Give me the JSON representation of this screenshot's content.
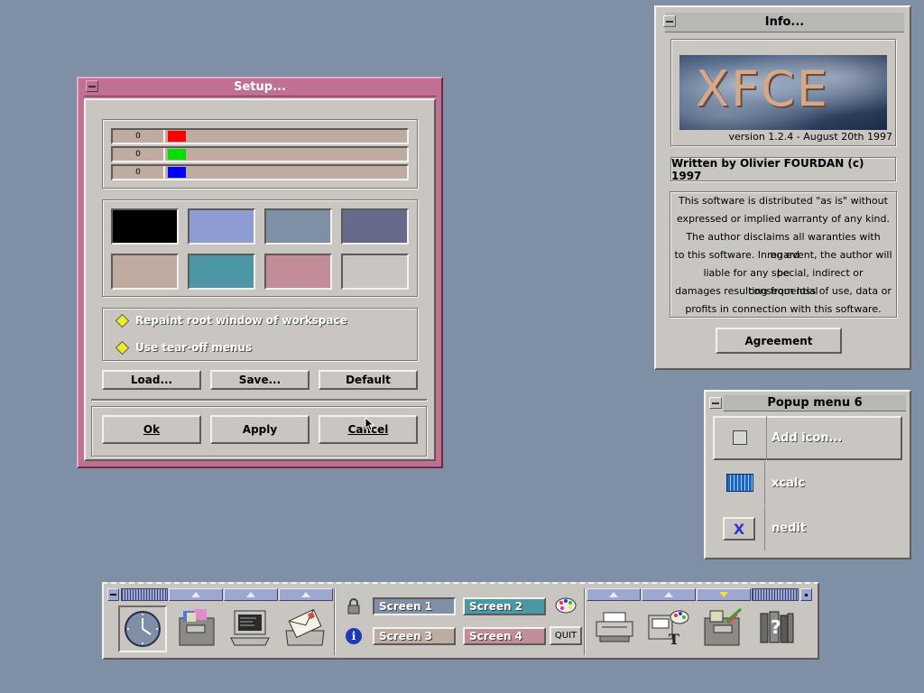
{
  "colors": {
    "desktop": "#7e8fa6",
    "window_face": "#c9c6c2",
    "active_title": "#c07092",
    "slider_trough": "#c0aba0",
    "panel_tab": "#9ea7cf"
  },
  "setup": {
    "title": "Setup...",
    "sliders": [
      {
        "value": "0",
        "color": "#ff0000"
      },
      {
        "value": "0",
        "color": "#00e000"
      },
      {
        "value": "0",
        "color": "#0000ff"
      }
    ],
    "swatches": [
      "#000000",
      "#8f9bd3",
      "#7e8fa6",
      "#676b8b",
      "#c0aba0",
      "#4b97a5",
      "#c38d98",
      "#c9c6c2"
    ],
    "options": {
      "repaint": "Repaint root window of workspace",
      "tearoff": "Use tear-off menus"
    },
    "buttons": {
      "load": "Load...",
      "save": "Save...",
      "default": "Default",
      "ok": "Ok",
      "apply": "Apply",
      "cancel": "Cancel"
    }
  },
  "info": {
    "title": "Info...",
    "logo_text": "XFCE",
    "version": "version 1.2.4 - August 20th 1997",
    "author": "Written by Olivier FOURDAN (c) 1997",
    "license_lines": [
      "This software is distributed \"as is\" without",
      "expressed or implied warranty of any kind.",
      "The author disclaims all waranties with regard",
      "to this software. In no event, the author will be",
      "liable for any special, indirect or consequential",
      "damages resulting from loss of use, data or",
      "profits in connection with this software."
    ],
    "agreement": "Agreement"
  },
  "popup": {
    "title": "Popup menu 6",
    "items": [
      {
        "label": "Add icon...",
        "icon": "add-icon"
      },
      {
        "label": "xcalc",
        "icon": "calculator-icon"
      },
      {
        "label": "nedit",
        "icon": "editor-icon"
      }
    ]
  },
  "panel": {
    "screens": [
      {
        "label": "Screen 1",
        "color": "#7e8fa6"
      },
      {
        "label": "Screen 2",
        "color": "#4b97a5"
      },
      {
        "label": "Screen 3",
        "color": "#c0aba0"
      },
      {
        "label": "Screen 4",
        "color": "#c38d98"
      }
    ],
    "quit": "QUIT",
    "left_icons": [
      "clock-icon",
      "file-manager-icon",
      "terminal-icon",
      "mail-icon"
    ],
    "right_icons": [
      "printer-icon",
      "paint-icon",
      "folder-edit-icon",
      "help-icon"
    ]
  }
}
